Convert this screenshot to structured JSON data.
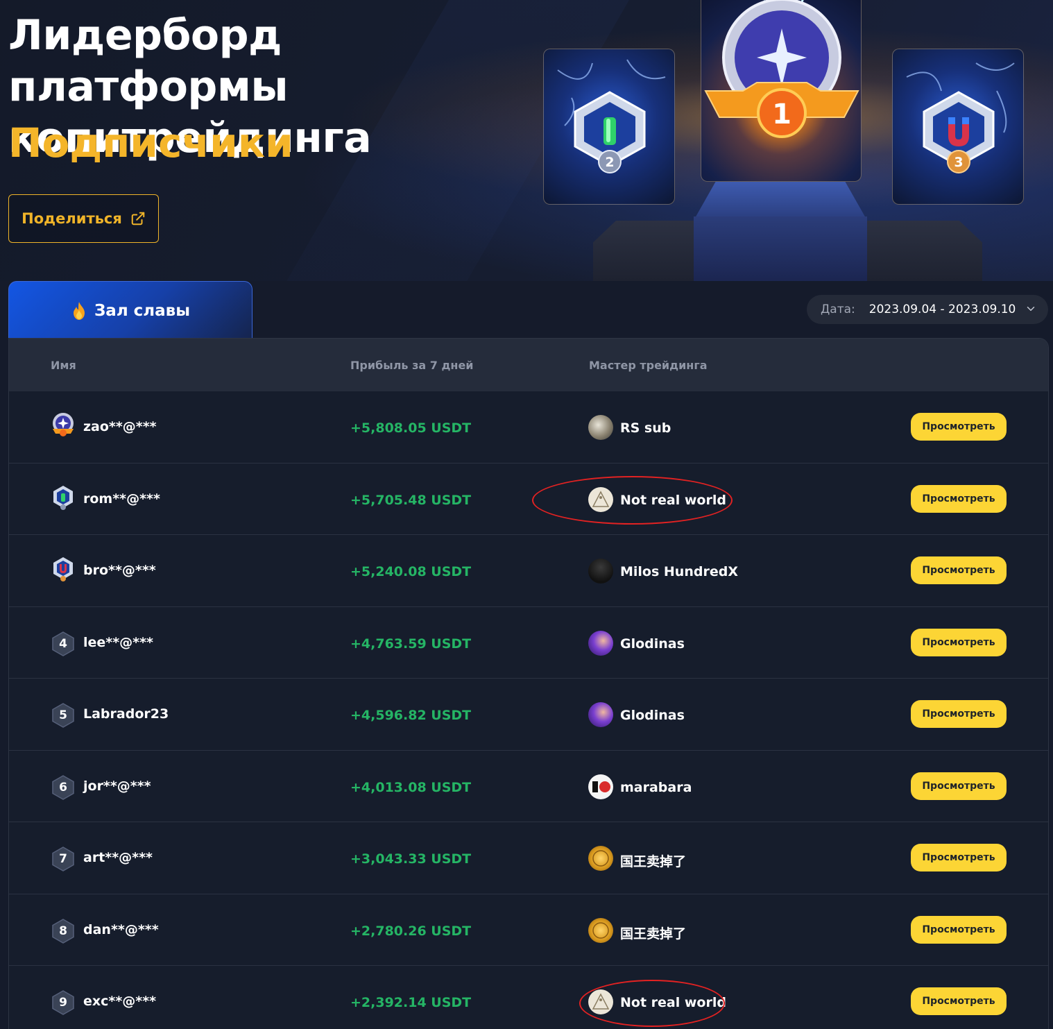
{
  "hero": {
    "title": "Лидерборд платформы копитрейдинга",
    "subtitle": "Подписчики",
    "share_label": "Поделиться",
    "podium_ranks": [
      "1",
      "2",
      "3"
    ]
  },
  "tabs": {
    "hall_of_fame": "Зал славы"
  },
  "date_filter": {
    "label": "Дата:",
    "value": "2023.09.04 - 2023.09.10"
  },
  "table": {
    "columns": [
      "Имя",
      "Прибыль за 7 дней",
      "Мастер трейдинга"
    ],
    "rows": [
      {
        "rank": "1",
        "name": "zao**@***",
        "profit": "+5,808.05 USDT",
        "master": "RS sub",
        "action": "Просмотреть"
      },
      {
        "rank": "2",
        "name": "rom**@***",
        "profit": "+5,705.48 USDT",
        "master": "Not real world",
        "action": "Просмотреть"
      },
      {
        "rank": "3",
        "name": "bro**@***",
        "profit": "+5,240.08 USDT",
        "master": "Milos HundredX",
        "action": "Просмотреть"
      },
      {
        "rank": "4",
        "name": "lee**@***",
        "profit": "+4,763.59 USDT",
        "master": "Glodinas",
        "action": "Просмотреть"
      },
      {
        "rank": "5",
        "name": "Labrador23",
        "profit": "+4,596.82 USDT",
        "master": "Glodinas",
        "action": "Просмотреть"
      },
      {
        "rank": "6",
        "name": "jor**@***",
        "profit": "+4,013.08 USDT",
        "master": "marabara",
        "action": "Просмотреть"
      },
      {
        "rank": "7",
        "name": "art**@***",
        "profit": "+3,043.33 USDT",
        "master": "国王卖掉了",
        "action": "Просмотреть"
      },
      {
        "rank": "8",
        "name": "dan**@***",
        "profit": "+2,780.26 USDT",
        "master": "国王卖掉了",
        "action": "Просмотреть"
      },
      {
        "rank": "9",
        "name": "exc**@***",
        "profit": "+2,392.14 USDT",
        "master": "Not real world",
        "action": "Просмотреть"
      }
    ]
  },
  "colors": {
    "accent_yellow": "#fcd535",
    "title_gold": "#f4b52a",
    "profit_green": "#25b565",
    "annotation_red": "#e32222"
  },
  "icons": {
    "share": "external-link-icon",
    "hall_tab": "flame-icon",
    "date": "chevron-down-icon"
  }
}
